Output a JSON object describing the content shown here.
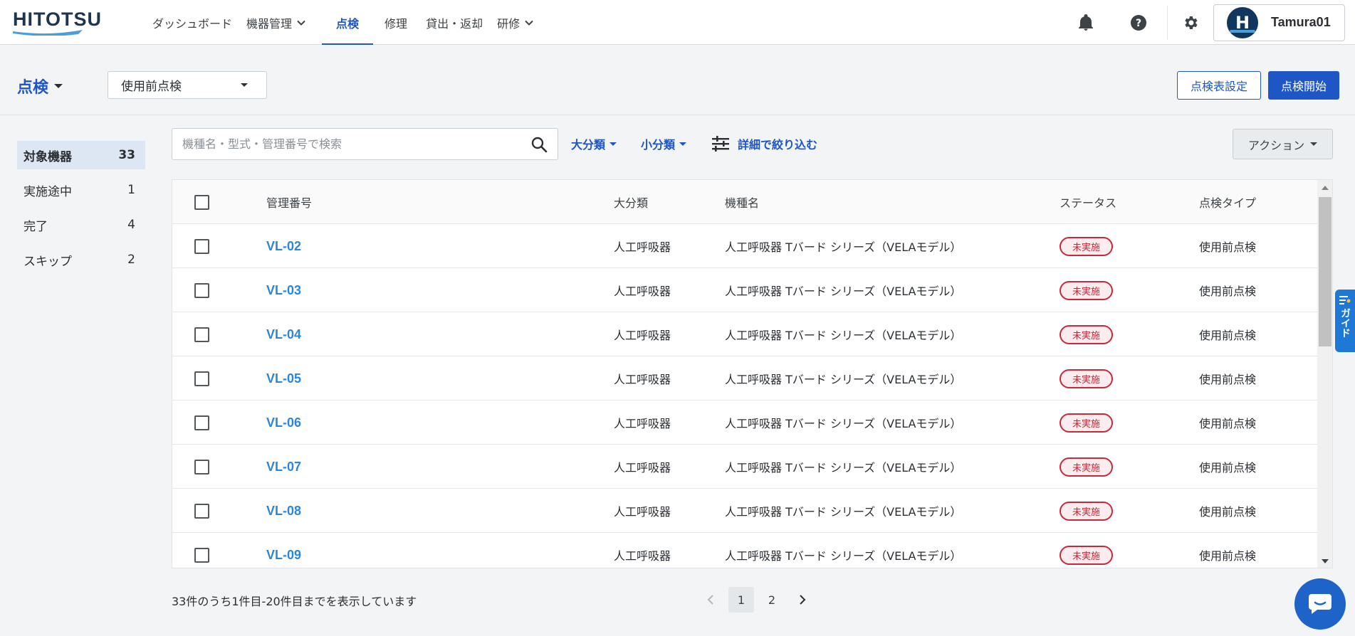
{
  "app": {
    "logo_text": "HITOTSU"
  },
  "nav": {
    "items": [
      {
        "label": "ダッシュボード",
        "dropdown": false,
        "active": false
      },
      {
        "label": "機器管理",
        "dropdown": true,
        "active": false
      },
      {
        "label": "点検",
        "dropdown": false,
        "active": true
      },
      {
        "label": "修理",
        "dropdown": false,
        "active": false
      },
      {
        "label": "貸出・返却",
        "dropdown": false,
        "active": false
      },
      {
        "label": "研修",
        "dropdown": true,
        "active": false
      }
    ]
  },
  "user": {
    "avatar_initial": "H",
    "name": "Tamura01"
  },
  "header": {
    "title": "点検",
    "inspection_type": "使用前点検",
    "settings_button": "点検表設定",
    "start_button": "点検開始"
  },
  "sidebar": {
    "items": [
      {
        "label": "対象機器",
        "count": "33"
      },
      {
        "label": "実施途中",
        "count": "1"
      },
      {
        "label": "完了",
        "count": "4"
      },
      {
        "label": "スキップ",
        "count": "2"
      }
    ]
  },
  "toolbar": {
    "search_placeholder": "機種名・型式・管理番号で検索",
    "category_major": "大分類",
    "category_minor": "小分類",
    "advanced_filter": "詳細で絞り込む",
    "action_button": "アクション"
  },
  "table": {
    "headers": {
      "id": "管理番号",
      "category": "大分類",
      "model": "機種名",
      "status": "ステータス",
      "type": "点検タイプ"
    },
    "rows": [
      {
        "id": "VL-02",
        "category": "人工呼吸器",
        "model": "人工呼吸器 Tバード シリーズ（VELAモデル）",
        "status": "未実施",
        "type": "使用前点検"
      },
      {
        "id": "VL-03",
        "category": "人工呼吸器",
        "model": "人工呼吸器 Tバード シリーズ（VELAモデル）",
        "status": "未実施",
        "type": "使用前点検"
      },
      {
        "id": "VL-04",
        "category": "人工呼吸器",
        "model": "人工呼吸器 Tバード シリーズ（VELAモデル）",
        "status": "未実施",
        "type": "使用前点検"
      },
      {
        "id": "VL-05",
        "category": "人工呼吸器",
        "model": "人工呼吸器 Tバード シリーズ（VELAモデル）",
        "status": "未実施",
        "type": "使用前点検"
      },
      {
        "id": "VL-06",
        "category": "人工呼吸器",
        "model": "人工呼吸器 Tバード シリーズ（VELAモデル）",
        "status": "未実施",
        "type": "使用前点検"
      },
      {
        "id": "VL-07",
        "category": "人工呼吸器",
        "model": "人工呼吸器 Tバード シリーズ（VELAモデル）",
        "status": "未実施",
        "type": "使用前点検"
      },
      {
        "id": "VL-08",
        "category": "人工呼吸器",
        "model": "人工呼吸器 Tバード シリーズ（VELAモデル）",
        "status": "未実施",
        "type": "使用前点検"
      },
      {
        "id": "VL-09",
        "category": "人工呼吸器",
        "model": "人工呼吸器 Tバード シリーズ（VELAモデル）",
        "status": "未実施",
        "type": "使用前点検"
      }
    ]
  },
  "footer": {
    "range_text": "33件のうち1件目-20件目までを表示しています",
    "pages": [
      "1",
      "2"
    ],
    "current_page": "1"
  },
  "guide": {
    "label": "ガイド"
  },
  "colors": {
    "primary": "#1e56c6",
    "link": "#2a87d8",
    "status_red": "#c8283a"
  }
}
